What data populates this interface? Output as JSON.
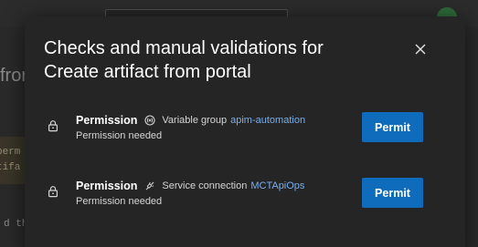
{
  "background": {
    "heading_fragment": "fror",
    "warning_lines": [
      "perm",
      "tifa"
    ],
    "log_fragment": "d th"
  },
  "dialog": {
    "title": "Checks and manual validations for Create artifact from portal",
    "close_icon": "close-icon",
    "checks": [
      {
        "kind": "Permission",
        "resource_icon": "variable-group-icon",
        "resource_type": "Variable group",
        "resource_name": "apim-automation",
        "status": "Permission needed",
        "action_label": "Permit"
      },
      {
        "kind": "Permission",
        "resource_icon": "service-connection-icon",
        "resource_type": "Service connection",
        "resource_name": "MCTApiOps",
        "status": "Permission needed",
        "action_label": "Permit"
      }
    ]
  },
  "colors": {
    "accent": "#0f6cbd",
    "link": "#7aaeea",
    "dialog_bg": "#252525"
  }
}
